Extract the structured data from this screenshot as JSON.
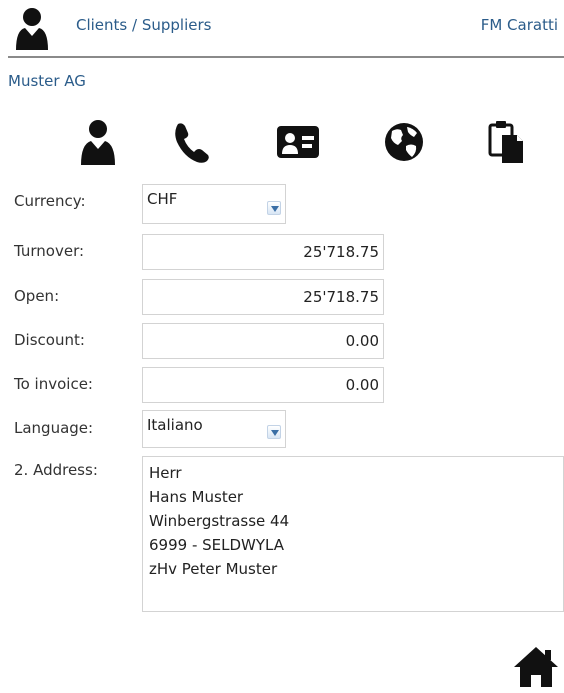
{
  "header": {
    "title": "Clients / Suppliers",
    "right": "FM Caratti",
    "user_icon": "user-icon"
  },
  "client": {
    "name": "Muster AG"
  },
  "toolbar": {
    "icons": [
      "user-icon",
      "phone-icon",
      "contact-card-icon",
      "globe-icon",
      "clipboard-icon"
    ]
  },
  "form": {
    "currency": {
      "label": "Currency:",
      "value": "CHF"
    },
    "turnover": {
      "label": "Turnover:",
      "value": "25'718.75"
    },
    "open": {
      "label": "Open:",
      "value": "25'718.75"
    },
    "discount": {
      "label": "Discount:",
      "value": "0.00"
    },
    "to_invoice": {
      "label": "To invoice:",
      "value": "0.00"
    },
    "language": {
      "label": "Language:",
      "value": "Italiano"
    },
    "address2": {
      "label": "2. Address:",
      "value": "Herr\nHans Muster\nWinbergstrasse 44\n6999 - SELDWYLA\nzHv Peter Muster"
    }
  },
  "footer": {
    "home_icon": "home-icon"
  }
}
